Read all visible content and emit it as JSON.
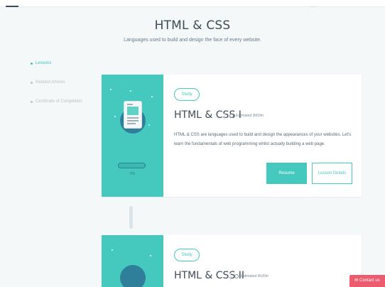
{
  "header": {
    "title": "HTML & CSS",
    "subtitle": "Languages used to build and design the face of every website."
  },
  "side_nav": {
    "items": [
      {
        "label": "Lessons",
        "active": true
      },
      {
        "label": "Related Articles",
        "active": false
      },
      {
        "label": "Certificate of Completion",
        "active": false
      }
    ]
  },
  "courses": [
    {
      "badge": "Study",
      "title": "HTML & CSS I",
      "estimate": "Estimated 3h50m",
      "description": "HTML & CSS are languages used to build and design the appearances of your websites. Let's learn the fundamentals of web programming whilst actually building a web page.",
      "progress_label": "0%",
      "progress": 0,
      "resume_label": "Resume",
      "details_label": "Lesson Details"
    },
    {
      "badge": "Study",
      "title": "HTML & CSS II",
      "estimate": "Estimated 4h30m"
    }
  ],
  "contact": {
    "label": "Contact us",
    "icon": "mail-icon"
  },
  "colors": {
    "accent": "#45c9be",
    "contact": "#ec5b6e",
    "art_dark": "#2f7f9a"
  }
}
